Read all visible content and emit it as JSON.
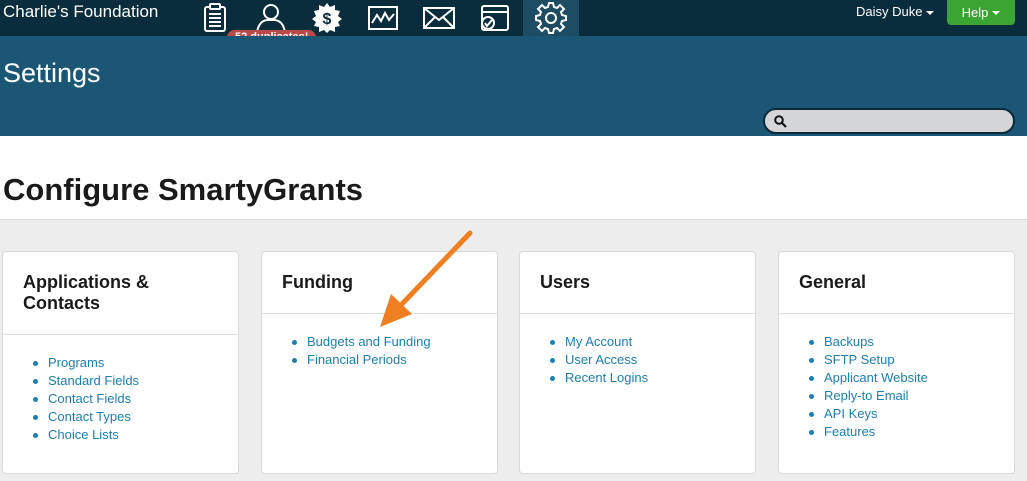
{
  "nav": {
    "brand": "Charlie's Foundation",
    "icons": [
      "clipboard-icon",
      "contacts-icon",
      "funding-icon",
      "reports-icon",
      "mail-icon",
      "tasks-icon",
      "settings-icon"
    ],
    "duplicates_badge": "52 duplicates!",
    "user_name": "Daisy Duke",
    "help_label": "Help"
  },
  "header": {
    "title": "Settings",
    "search_placeholder": ""
  },
  "main": {
    "title": "Configure SmartyGrants",
    "cards": [
      {
        "title": "Applications & Contacts",
        "items": [
          "Programs",
          "Standard Fields",
          "Contact Fields",
          "Contact Types",
          "Choice Lists"
        ]
      },
      {
        "title": "Funding",
        "items": [
          "Budgets and Funding",
          "Financial Periods"
        ]
      },
      {
        "title": "Users",
        "items": [
          "My Account",
          "User Access",
          "Recent Logins"
        ]
      },
      {
        "title": "General",
        "items": [
          "Backups",
          "SFTP Setup",
          "Applicant Website",
          "Reply-to Email",
          "API Keys",
          "Features"
        ]
      }
    ]
  },
  "colors": {
    "topnav": "#0a2d3d",
    "header": "#1b5775",
    "link": "#1b7fb2",
    "help_button": "#3ba534",
    "badge": "#b94a48",
    "arrow": "#f07f22"
  }
}
